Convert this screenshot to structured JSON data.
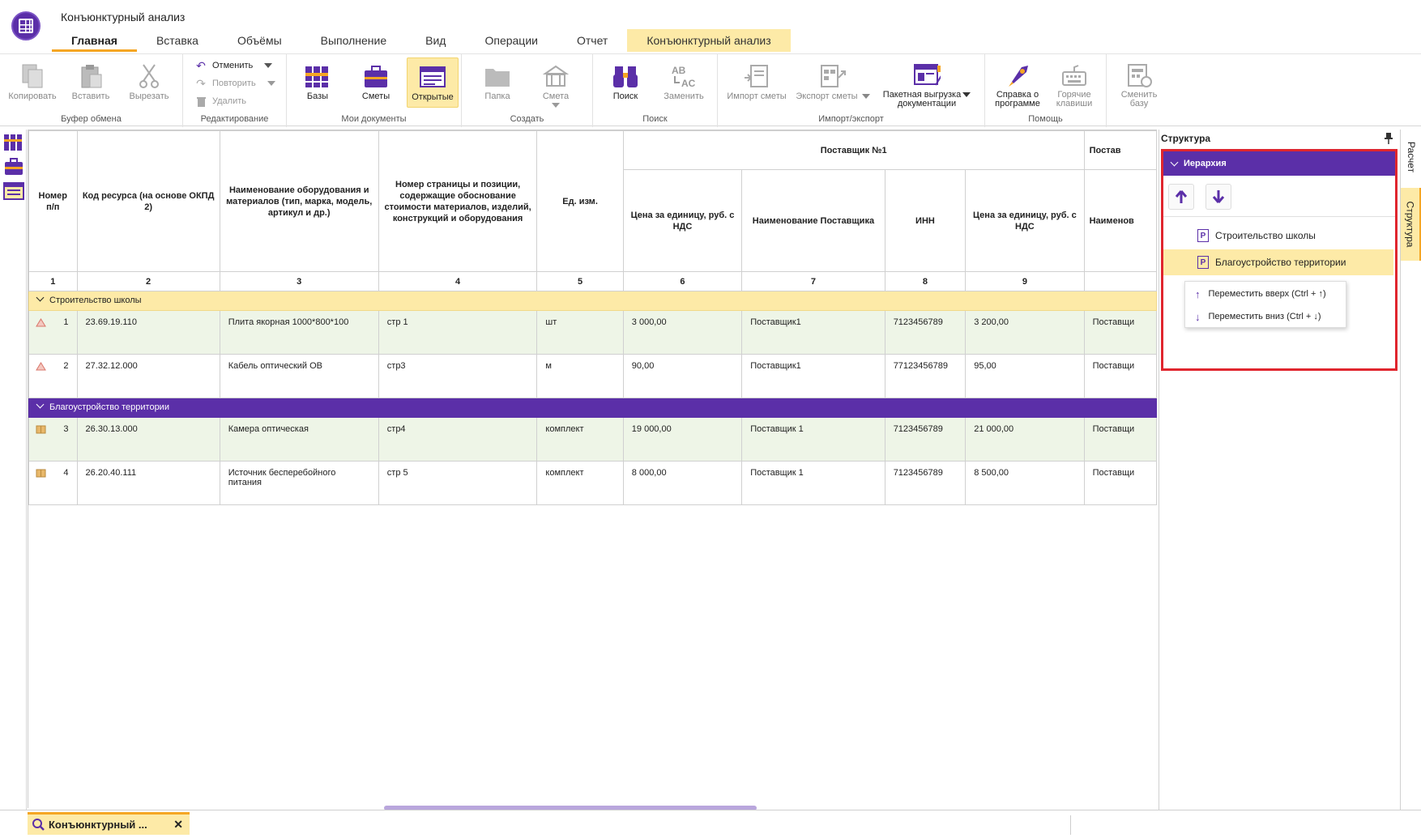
{
  "app": {
    "title": "Конъюнктурный анализ"
  },
  "tabs": [
    "Главная",
    "Вставка",
    "Объёмы",
    "Выполнение",
    "Вид",
    "Операции",
    "Отчет",
    "Конъюнктурный анализ"
  ],
  "ribbon": {
    "clipboard": {
      "label": "Буфер обмена",
      "copy": "Копировать",
      "paste": "Вставить",
      "cut": "Вырезать"
    },
    "editing": {
      "label": "Редактирование",
      "undo": "Отменить",
      "redo": "Повторить",
      "delete": "Удалить"
    },
    "my_docs": {
      "label": "Мои документы",
      "bases": "Базы",
      "estimates": "Сметы",
      "open": "Открытые"
    },
    "create": {
      "label": "Создать",
      "folder": "Папка",
      "estimate": "Смета"
    },
    "search": {
      "label": "Поиск",
      "find": "Поиск",
      "replace": "Заменить"
    },
    "import_export": {
      "label": "Импорт/экспорт",
      "import": "Импорт сметы",
      "export": "Экспорт сметы",
      "batch1": "Пакетная выгрузка",
      "batch2": "документации"
    },
    "help": {
      "label": "Помощь",
      "about1": "Справка о",
      "about2": "программе",
      "hotkeys1": "Горячие",
      "hotkeys2": "клавиши"
    },
    "switch": {
      "label1": "Сменить",
      "label2": "базу"
    }
  },
  "table": {
    "header": {
      "num": "Номер п/п",
      "code": "Код ресурса (на основе ОКПД 2)",
      "name": "Наименование оборудования и материалов (тип, марка, модель, артикул и др.)",
      "page": "Номер страницы и позиции, содержащие обоснование стоимости материалов, изделий, конструкций и оборудования",
      "unit": "Ед. изм.",
      "supplier1": "Поставщик №1",
      "supplier2": "Постав",
      "price": "Цена за единицу, руб. с НДС",
      "supplier_name": "Наименование Поставщика",
      "inn": "ИНН",
      "price2": "Цена за единицу, руб. с НДС",
      "name_cut": "Наименов"
    },
    "col_numbers": [
      "1",
      "2",
      "3",
      "4",
      "5",
      "6",
      "7",
      "8",
      "9",
      ""
    ],
    "groups": [
      {
        "title": "Строительство школы",
        "rows": [
          {
            "n": "1",
            "code": "23.69.19.110",
            "name": "Плита якорная 1000*800*100",
            "page": "стр 1",
            "unit": "шт",
            "price": "3 000,00",
            "supplier": "Поставщик1",
            "inn": "7123456789",
            "price2": "3 200,00",
            "sup2": "Поставщи"
          },
          {
            "n": "2",
            "code": "27.32.12.000",
            "name": "Кабель оптический ОВ",
            "page": "стр3",
            "unit": "м",
            "price": "90,00",
            "supplier": "Поставщик1",
            "inn": "77123456789",
            "price2": "95,00",
            "sup2": "Поставщи"
          }
        ]
      },
      {
        "title": "Благоустройство территории",
        "rows": [
          {
            "n": "3",
            "code": "26.30.13.000",
            "name": "Камера оптическая",
            "page": "стр4",
            "unit": "комплект",
            "price": "19 000,00",
            "supplier": "Поставщик 1",
            "inn": "7123456789",
            "price2": "21 000,00",
            "sup2": "Поставщи"
          },
          {
            "n": "4",
            "code": "26.20.40.111",
            "name": "Источник бесперебойного питания",
            "page": "стр 5",
            "unit": "комплект",
            "price": "8 000,00",
            "supplier": "Поставщик 1",
            "inn": "7123456789",
            "price2": "8 500,00",
            "sup2": "Поставщи"
          }
        ]
      }
    ]
  },
  "structure": {
    "title": "Структура",
    "hierarchy": "Иерархия",
    "items": [
      "Строительство школы",
      "Благоустройство территории"
    ],
    "context_menu": [
      "Переместить вверх (Ctrl + ↑)",
      "Переместить вниз (Ctrl + ↓)"
    ]
  },
  "vtabs": [
    "Расчет",
    "Структура"
  ],
  "bottom": {
    "doc_tab": "Конъюнктурный ..."
  },
  "colors": {
    "accent": "#5b2fa8",
    "highlight": "#fdeaa7",
    "orange": "#f5a623",
    "red_frame": "#e0262e"
  }
}
